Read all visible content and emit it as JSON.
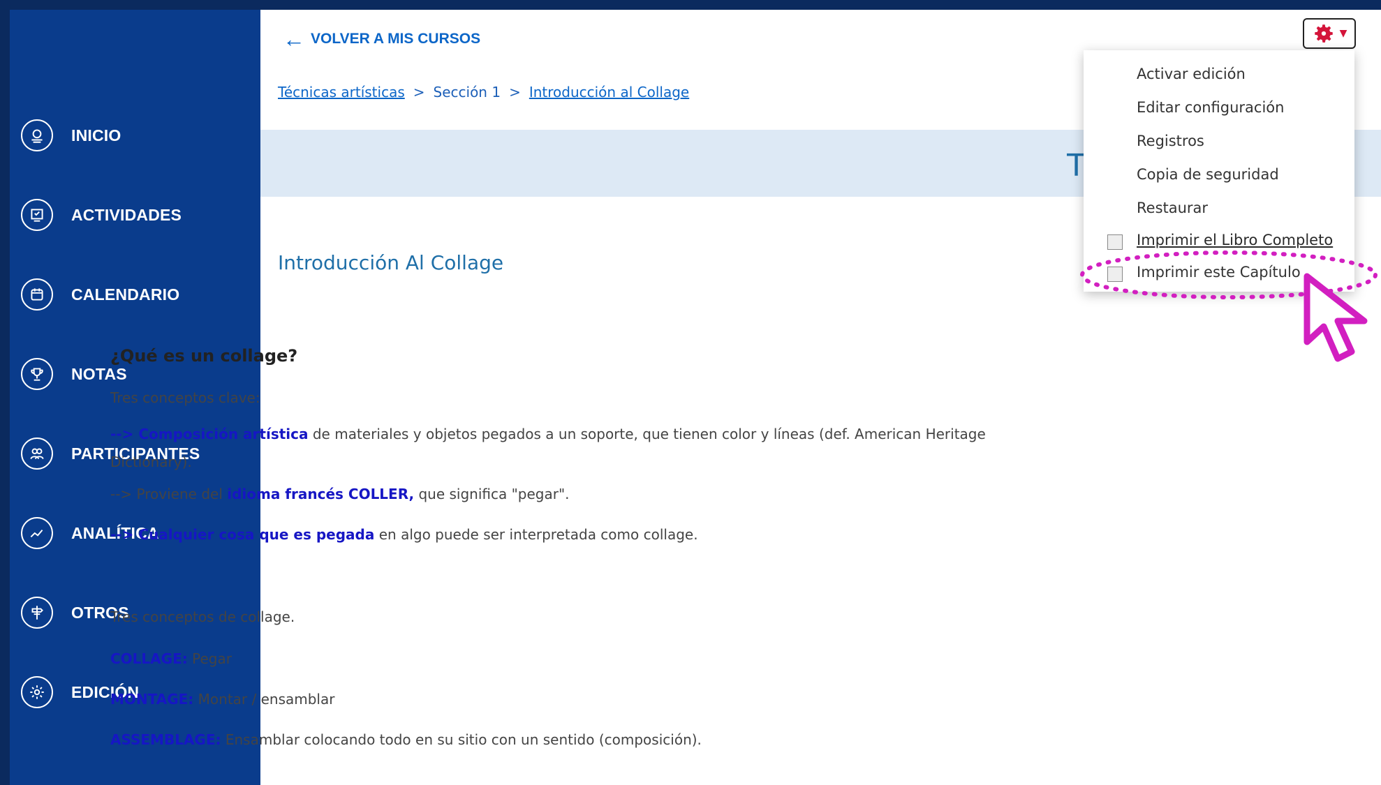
{
  "sidebar": {
    "items": [
      {
        "label": "INICIO",
        "icon": "home-icon"
      },
      {
        "label": "ACTIVIDADES",
        "icon": "activities-icon"
      },
      {
        "label": "CALENDARIO",
        "icon": "calendar-icon"
      },
      {
        "label": "NOTAS",
        "icon": "trophy-icon"
      },
      {
        "label": "PARTICIPANTES",
        "icon": "participants-icon"
      },
      {
        "label": "ANALÍTICA",
        "icon": "analytics-icon"
      },
      {
        "label": "OTROS",
        "icon": "signpost-icon"
      },
      {
        "label": "EDICIÓN",
        "icon": "gear-icon"
      }
    ]
  },
  "header": {
    "back_label": "VOLVER A MIS CURSOS",
    "breadcrumb": [
      "Técnicas artísticas",
      "Sección 1",
      "Introducción al Collage"
    ],
    "banner_title": "TI"
  },
  "chapter": {
    "title": "Introducción Al Collage",
    "heading": "¿Qué es un collage?",
    "p1": "Tres conceptos clave:",
    "p2_hl": "--> Composición artística",
    "p2_rest": " de materiales y objetos pegados a un soporte, que tienen color y líneas  (def. American Heritage",
    "p2_cont": "Dictionary).",
    "p3_pre": "--> Proviene del ",
    "p3_hl": "idioma francés COLLER,",
    "p3_rest": " que significa \"pegar\".",
    "p4_hl": "--> Cualquier cosa que es pegada",
    "p4_rest": " en algo puede ser interpretada como collage.",
    "p5": "Tres conceptos de collage.",
    "c1_hl": "COLLAGE:",
    "c1_rest": " Pegar",
    "c2_hl": "MONTAGE:",
    "c2_rest": " Montar / ensamblar",
    "c3_hl": "ASSEMBLAGE:",
    "c3_rest": " Ensamblar colocando todo en su sitio con un sentido (composición)."
  },
  "menu": {
    "items": [
      "Activar edición",
      "Editar configuración",
      "Registros",
      "Copia de seguridad",
      "Restaurar",
      "Imprimir el Libro Completo",
      "Imprimir este Capítulo"
    ]
  },
  "colors": {
    "sidebar": "#0a3c8c",
    "accent": "#0c66c8",
    "highlight": "#d21fc0"
  }
}
